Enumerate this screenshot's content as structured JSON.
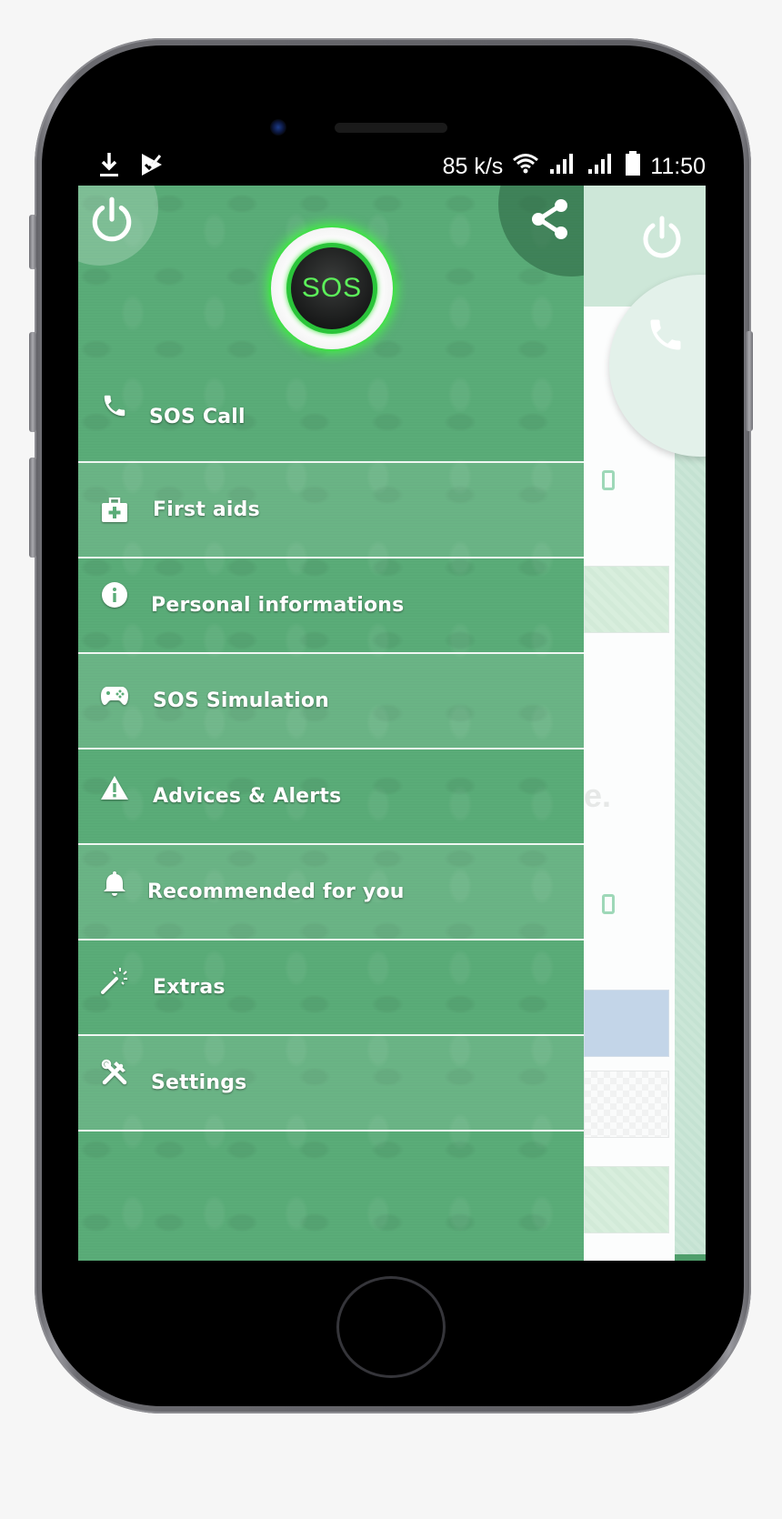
{
  "status_bar": {
    "left_icons": [
      "download-icon",
      "play-store-check-icon"
    ],
    "network_speed": "85 k/s",
    "right_icons": [
      "wifi-icon",
      "signal-icon",
      "signal-icon-2",
      "battery-icon"
    ],
    "time": "11:50"
  },
  "drawer": {
    "header": {
      "power_icon": "power-icon",
      "share_icon": "share-icon",
      "sos_button_label": "SOS"
    },
    "menu_items": [
      {
        "label": "SOS Call",
        "icon": "phone-icon"
      },
      {
        "label": "First aids",
        "icon": "first-aid-kit-icon"
      },
      {
        "label": "Personal informations",
        "icon": "info-icon"
      },
      {
        "label": "SOS Simulation",
        "icon": "gamepad-icon"
      },
      {
        "label": "Advices & Alerts",
        "icon": "warning-icon"
      },
      {
        "label": "Recommended for you",
        "icon": "bell-icon"
      },
      {
        "label": "Extras",
        "icon": "magic-wand-icon"
      },
      {
        "label": "Settings",
        "icon": "tools-icon"
      }
    ]
  },
  "background_app": {
    "power_icon": "power-icon",
    "call_icon": "phone-icon",
    "faint_text": "e."
  },
  "colors": {
    "drawer_green": "#5aac78",
    "sos_glow": "#45ff45",
    "sos_text": "#5cf05a",
    "background_header": "#cde7d8",
    "block_blue": "#c3d5e8",
    "block_green": "#d4ebd9"
  }
}
